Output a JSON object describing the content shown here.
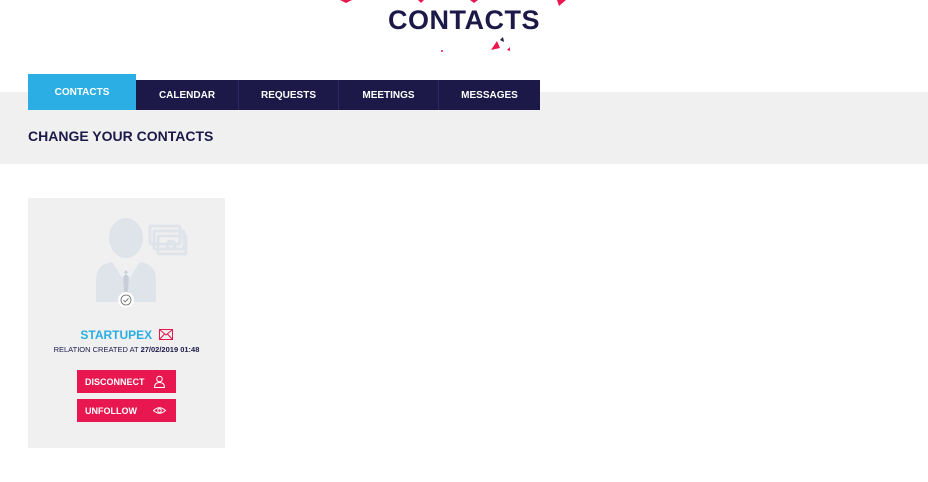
{
  "header": {
    "title": "CONTACTS"
  },
  "tabs": [
    {
      "label": "CONTACTS",
      "active": true
    },
    {
      "label": "CALENDAR",
      "active": false
    },
    {
      "label": "REQUESTS",
      "active": false
    },
    {
      "label": "MEETINGS",
      "active": false
    },
    {
      "label": "MESSAGES",
      "active": false
    }
  ],
  "section": {
    "title": "CHANGE YOUR CONTACTS"
  },
  "contact": {
    "name": "STARTUPEX",
    "relation_prefix": "RELATION CREATED AT",
    "relation_date": "27/02/2019 01:48",
    "disconnect_label": "DISCONNECT",
    "unfollow_label": "UNFOLLOW"
  },
  "colors": {
    "navy": "#1c1949",
    "accent_blue": "#2aaee3",
    "accent_pink": "#e8174f",
    "band_grey": "#f0f0f0"
  },
  "icons": [
    "confetti-decoration",
    "avatar-icon",
    "money-icon",
    "check-icon",
    "mail-icon",
    "user-icon",
    "eye-icon"
  ]
}
